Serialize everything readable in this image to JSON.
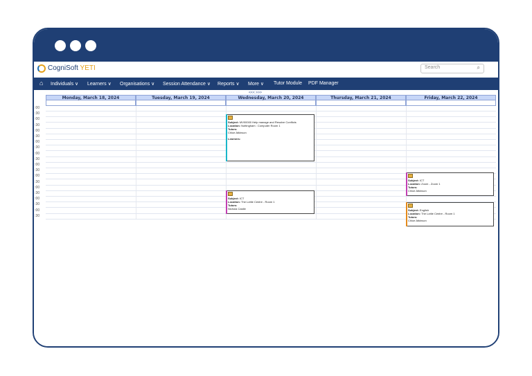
{
  "app": {
    "logo_main": "CogniSoft",
    "logo_accent": "YETI",
    "search_placeholder": "Search"
  },
  "nav": {
    "items": [
      "Individuals ∨",
      "Learners ∨",
      "Organisations ∨",
      "Session Attendance ∨",
      "Reports ∨",
      "More ∨",
      "Tutor Module",
      "PDF Manager"
    ]
  },
  "calendar": {
    "nav_arrows": "<<<  >>>",
    "days": [
      "Monday, March 18, 2024",
      "Tuesday, March 19, 2024",
      "Wednesday, March 20, 2024",
      "Thursday, March 21, 2024",
      "Friday, March 22, 2024"
    ],
    "times": [
      "8 :00",
      "8 :30",
      "9 :00",
      "9 :30",
      "0 :00",
      "0 :30",
      "1 :00",
      "1 :30",
      "2 :00",
      "2 :30",
      "3 :00",
      "3 :30",
      "4 :00",
      "4 :30",
      "5 :00",
      "5 :30",
      "6 :00",
      "6 :30",
      "7 :00",
      "7 :30"
    ],
    "events": [
      {
        "subject_label": "Subject:",
        "subject": "MV00000 Help manage and Resolve Conflicts",
        "location_label": "Location:",
        "location": "Nottingham : Computer Room 1",
        "tutors_label": "Tutors:",
        "tutors": "Chloe Atkinson",
        "learners_label": "Learners:",
        "accent": "#19b6c9"
      },
      {
        "subject_label": "Subject:",
        "subject": "ICT",
        "location_label": "Location:",
        "location": "The Lottie Centre - Room 1",
        "tutors_label": "Tutors:",
        "tutors": "Nichola Castle",
        "accent": "#c23fb3"
      },
      {
        "subject_label": "Subject:",
        "subject": "ICT",
        "location_label": "Location:",
        "location": "Zoom - Zoom 1",
        "tutors_label": "Tutors:",
        "tutors": "Chloe Atkinson",
        "accent": "#c23fb3"
      },
      {
        "subject_label": "Subject:",
        "subject": "English",
        "location_label": "Location:",
        "location": "The Lottie Centre - Room 1",
        "tutors_label": "Tutors:",
        "tutors": "Chloe Atkinson",
        "accent": "#e58a1a"
      }
    ]
  }
}
